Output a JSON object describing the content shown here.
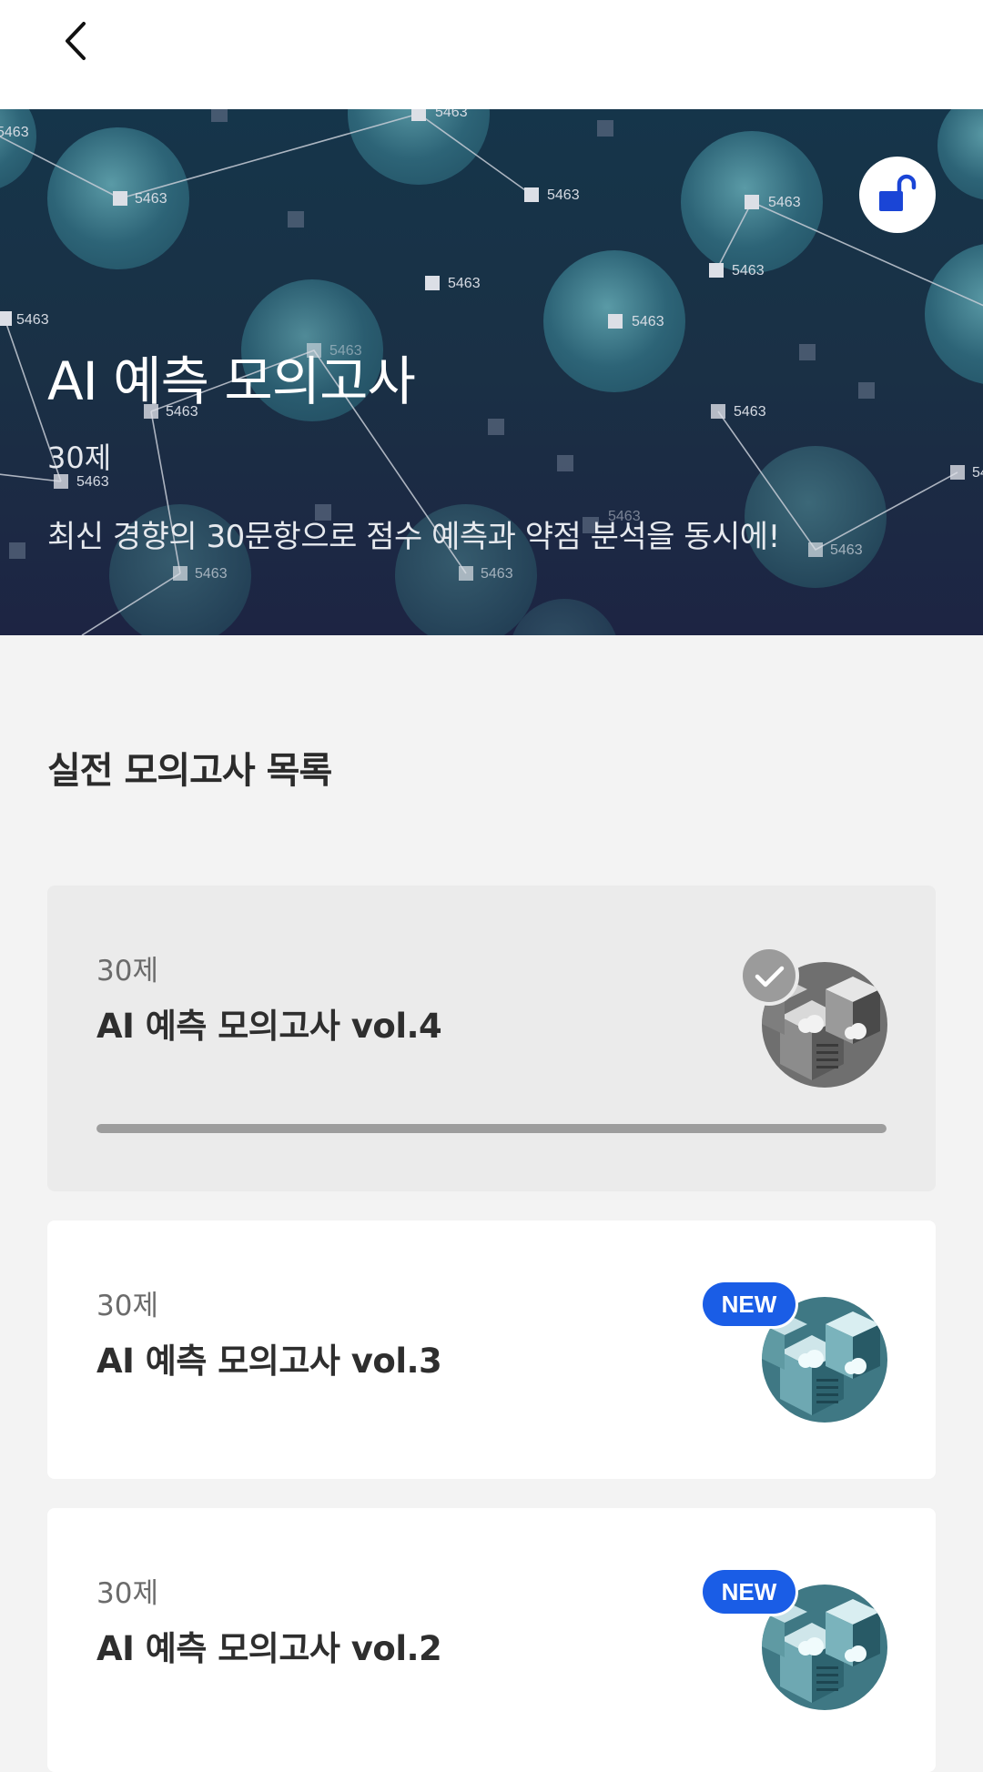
{
  "hero": {
    "title": "AI 예측 모의고사",
    "count": "30제",
    "description": "최신 경향의 30문항으로 점수 예측과 약점 분석을 동시에!",
    "node_label": "5463",
    "lock_state": "unlocked"
  },
  "section": {
    "title": "실전 모의고사 목록"
  },
  "exams": [
    {
      "count": "30제",
      "name": "AI 예측 모의고사 vol.4",
      "status": "completed",
      "progress": 1.0,
      "thumb_color": "#7a7a7a"
    },
    {
      "count": "30제",
      "name": "AI 예측 모의고사 vol.3",
      "status": "new",
      "badge": "NEW",
      "thumb_color": "#5f9aa3"
    },
    {
      "count": "30제",
      "name": "AI 예측 모의고사 vol.2",
      "status": "new",
      "badge": "NEW",
      "thumb_color": "#5f9aa3"
    }
  ],
  "colors": {
    "accent": "#1a5de6",
    "lock_icon": "#1a45d6",
    "hero_bg": "#1a3045"
  },
  "icons": {
    "back": "chevron-left-icon",
    "lock": "unlock-icon",
    "check": "check-icon"
  }
}
